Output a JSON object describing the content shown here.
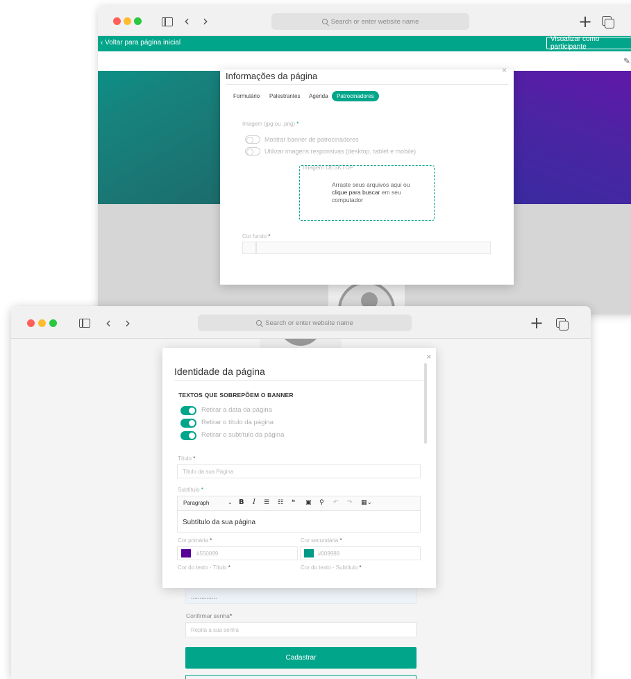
{
  "browser": {
    "url_placeholder": "Search or enter website name"
  },
  "back_window": {
    "back_link": "Voltar para página inicial",
    "view_as_participant": "Visualizar como participante",
    "modal": {
      "title": "Informações da página",
      "tabs": [
        "Formulário",
        "Palestrantes",
        "Agenda",
        "Patrocinadores"
      ],
      "active_tab": "Patrocinadores",
      "image_label": "Imagem (jpg ou .png)",
      "toggle_1": "Mostrar banner de patrocinadores",
      "toggle_2": "Utilizar imagens responsivas (desktop, tablet e mobile)",
      "desktop_label": "Imagem DESKTOP",
      "drop_line1": "Arraste seus arquivos aqui ou",
      "drop_link": "clique para buscar",
      "drop_line2_rest": " em seu",
      "drop_line3": "computador",
      "bg_color_label": "Cor fundo"
    }
  },
  "front_window": {
    "modal": {
      "title": "Identidade da página",
      "section_title": "TEXTOS QUE SOBREPÕEM O BANNER",
      "toggles": [
        "Retirar a data da página",
        "Retirar o título da página",
        "Retirar o subtítulo da página"
      ],
      "title_label": "Título",
      "title_placeholder": "Título da sua Página",
      "subtitle_label": "Subtítulo",
      "toolbar_paragraph": "Paragraph",
      "subtitle_value": "Subtítulo da sua página",
      "primary_color_label": "Cor primária",
      "primary_color_value": "#550099",
      "secondary_color_label": "Cor secundária",
      "secondary_color_value": "#009988",
      "text_color_title_label": "Cor do texto - Título",
      "text_color_subtitle_label": "Cor do texto - Subtítulo"
    },
    "form": {
      "password_value": "...............",
      "confirm_label": "Confirmar senha",
      "confirm_placeholder": "Repita a sua senha",
      "submit_label": "Cadastrar"
    }
  },
  "colors": {
    "accent": "#00a58a",
    "primary_swatch": "#550099",
    "secondary_swatch": "#009988"
  },
  "icons": [
    "sidebar-icon",
    "chevron-left-icon",
    "chevron-right-icon",
    "search-icon",
    "plus-icon",
    "tabs-icon",
    "pencil-icon",
    "close-icon",
    "bold-icon",
    "italic-icon",
    "bullet-list-icon",
    "numbered-list-icon",
    "quote-icon",
    "image-icon",
    "link-icon",
    "undo-icon",
    "redo-icon",
    "table-icon"
  ]
}
